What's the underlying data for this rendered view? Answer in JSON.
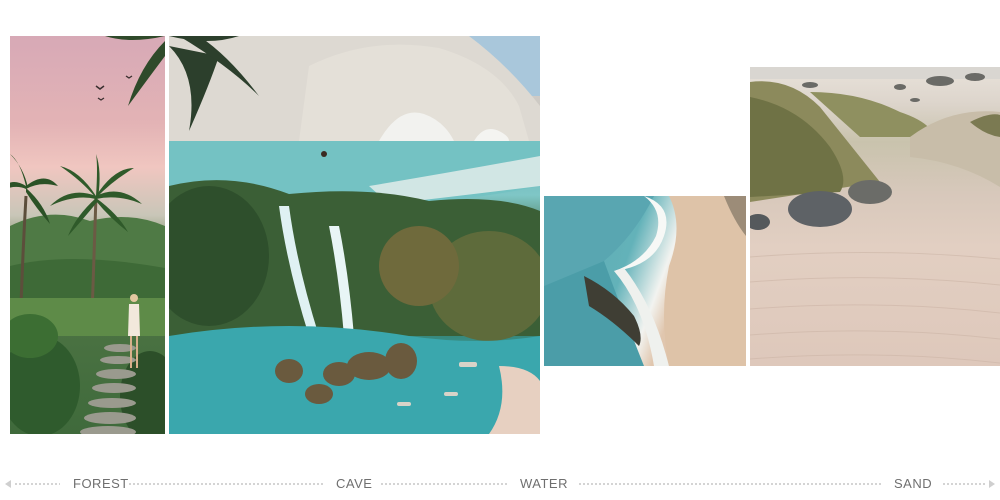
{
  "gallery": {
    "panels": [
      {
        "id": "forest",
        "description": "forest"
      },
      {
        "id": "cave",
        "description": "cave"
      },
      {
        "id": "water",
        "description": "water"
      },
      {
        "id": "sand",
        "description": "sand"
      }
    ]
  },
  "nav": {
    "items": [
      {
        "label": "FOREST"
      },
      {
        "label": "CAVE"
      },
      {
        "label": "WATER"
      },
      {
        "label": "SAND"
      }
    ]
  },
  "colors": {
    "background": "#ffffff",
    "nav_text": "#6f6f6f",
    "dots": "#c9c9c9"
  }
}
